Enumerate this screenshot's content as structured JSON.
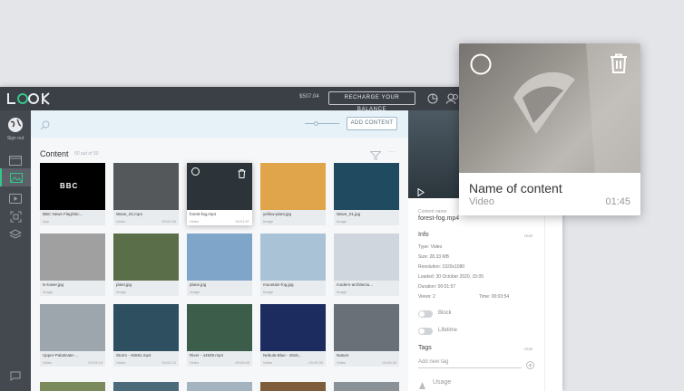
{
  "topbar": {
    "logo": "LOOK",
    "balance": "$507.04",
    "recharge_label": "RECHARGE YOUR BALANCE"
  },
  "sidebar": {
    "signout_label": "Sign out",
    "items": [
      "image-icon",
      "video-icon",
      "scan-icon",
      "layers-icon",
      "chat-icon"
    ]
  },
  "toolbar": {
    "add_content_label": "ADD CONTENT",
    "zoom": 0.35
  },
  "content": {
    "heading": "Content",
    "count": "50 out of 50"
  },
  "cards": [
    {
      "name": "BBC News Flag/Stic...",
      "type": "Ape",
      "duration": "",
      "thumb": "#000000",
      "overlay": "BBC"
    },
    {
      "name": "Wave_02.mp4",
      "type": "Video",
      "duration": "00:02:30",
      "thumb": "#55585b"
    },
    {
      "name": "forest-fog.mp4",
      "type": "Video",
      "duration": "00:01:57",
      "thumb": "#2c3339",
      "highlight": true
    },
    {
      "name": "yellow-plant.jpg",
      "type": "Image",
      "duration": "",
      "thumb": "#e0a54a"
    },
    {
      "name": "Wave_01.jpg",
      "type": "Image",
      "duration": "",
      "thumb": "#1f4a60"
    },
    {
      "name": "tv-tower.jpg",
      "type": "Image",
      "duration": "",
      "thumb": "#a0a0a0"
    },
    {
      "name": "plant.jpg",
      "type": "Image",
      "duration": "",
      "thumb": "#5b6e4a"
    },
    {
      "name": "plane.jpg",
      "type": "Image",
      "duration": "",
      "thumb": "#7fa5c9"
    },
    {
      "name": "mountain-fog.jpg",
      "type": "Image",
      "duration": "",
      "thumb": "#a9c2d6"
    },
    {
      "name": "modern-architectu...",
      "type": "Image",
      "duration": "",
      "thumb": "#cfd6de"
    },
    {
      "name": "Upper-Palatinate-...",
      "type": "Video",
      "duration": "00:03:10",
      "thumb": "#9da6ad"
    },
    {
      "name": "Storm - 46591.mp4",
      "type": "Video",
      "duration": "00:02:13",
      "thumb": "#2e4f5f"
    },
    {
      "name": "River - 44509.mp4",
      "type": "Video",
      "duration": "00:00:45",
      "thumb": "#3b5d4a"
    },
    {
      "name": "Nebula-Blue - 4915...",
      "type": "Video",
      "duration": "00:00:30",
      "thumb": "#1d2c5e"
    },
    {
      "name": "Nature",
      "type": "Video",
      "duration": "00:00:30",
      "thumb": "#6a7078"
    }
  ],
  "detail": {
    "content_name_label": "Content name",
    "content_name": "forest-fog.mp4",
    "info_label": "Info",
    "hide_label": "Hide",
    "rows": {
      "type": "Type: Video",
      "size": "Size: 28.33 MB",
      "resolution": "Resolution: 1920x1080",
      "loaded": "Loaded: 30 October 2020, 15:05",
      "duration": "Duration: 00:01:57",
      "views": "Views: 2",
      "time": "Time: 00:03:54"
    },
    "block_label": "Block",
    "lifetime_label": "Lifetime",
    "tags_label": "Tags",
    "tags_hide": "Hide",
    "tag_placeholder": "Add new tag",
    "usage_label": "Usage"
  },
  "popup": {
    "title": "Name of content",
    "type": "Video",
    "duration": "01:45"
  },
  "colors": {
    "accent": "#34c789",
    "topbar": "#3b3f46",
    "sidebar": "#44484f",
    "toolbar": "#e7f1f8"
  }
}
